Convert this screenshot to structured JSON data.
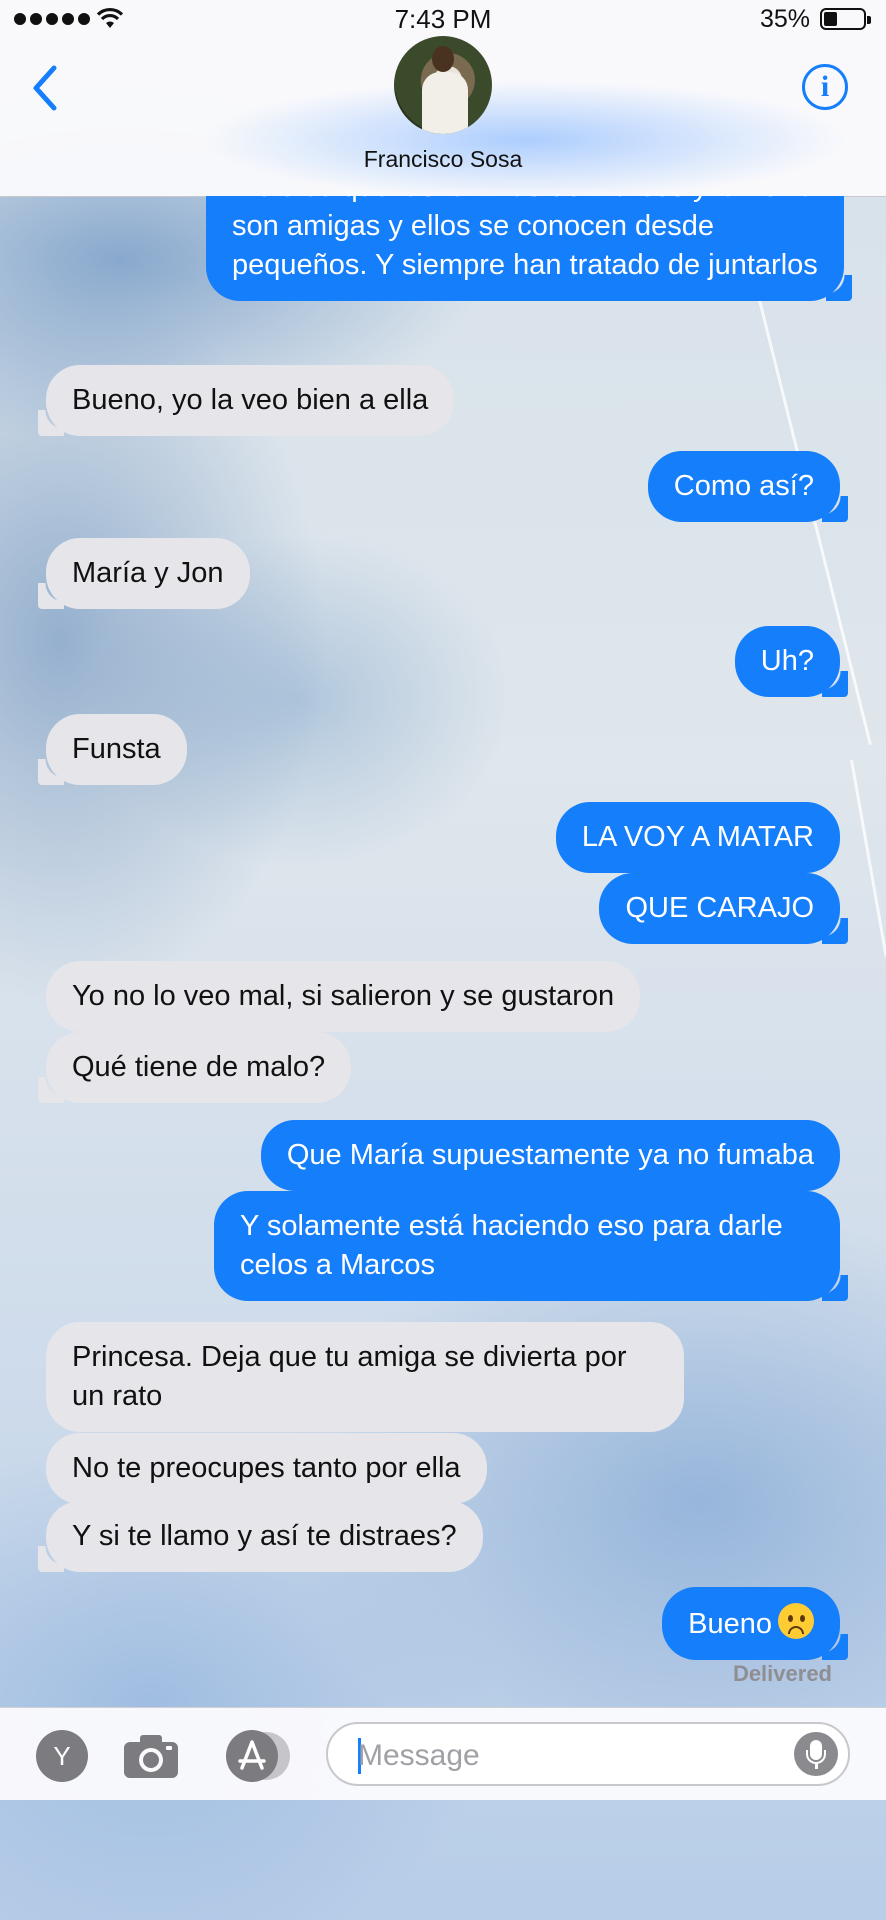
{
  "status_bar": {
    "time": "7:43 PM",
    "battery_percent": "35%",
    "battery_level": 0.35,
    "signal_bars": 5
  },
  "header": {
    "contact_name": "Francisco Sosa",
    "back_icon": "chevron-left-icon",
    "info_icon": "info-icon"
  },
  "messages": [
    {
      "direction": "outgoing",
      "text": "Me dice que las familias de Marcos y la novia son amigas y ellos se conocen desde pequeños. Y siempre han tratado de juntarlos"
    },
    {
      "direction": "incoming",
      "text": "Bueno, yo la veo bien a ella"
    },
    {
      "direction": "outgoing",
      "text": "Como así?"
    },
    {
      "direction": "incoming",
      "text": "María y Jon"
    },
    {
      "direction": "outgoing",
      "text": "Uh?"
    },
    {
      "direction": "incoming",
      "text": "Funsta"
    },
    {
      "direction": "outgoing",
      "text": "LA VOY A MATAR"
    },
    {
      "direction": "outgoing",
      "text": "QUE CARAJO"
    },
    {
      "direction": "incoming",
      "text": "Yo no lo veo mal, si salieron y se gustaron"
    },
    {
      "direction": "incoming",
      "text": "Qué tiene de malo?"
    },
    {
      "direction": "outgoing",
      "text": "Que María supuestamente ya no fumaba"
    },
    {
      "direction": "outgoing",
      "text": "Y solamente está haciendo eso para darle celos a Marcos"
    },
    {
      "direction": "incoming",
      "text": "Princesa. Deja que tu amiga se divierta por un rato"
    },
    {
      "direction": "incoming",
      "text": "No te preocupes tanto por ella"
    },
    {
      "direction": "incoming",
      "text": "Y si te llamo y así te distraes?"
    },
    {
      "direction": "outgoing",
      "text": "Bueno",
      "emoji": "frowning-face"
    }
  ],
  "delivery_status": "Delivered",
  "input_bar": {
    "profile_button_label": "Y",
    "camera_icon": "camera-icon",
    "app_store_icon": "app-store-icon",
    "message_placeholder": "Message",
    "mic_icon": "microphone-icon"
  },
  "colors": {
    "outgoing_bubble": "#157efb",
    "incoming_bubble": "#e5e5ea",
    "accent": "#157efb"
  }
}
